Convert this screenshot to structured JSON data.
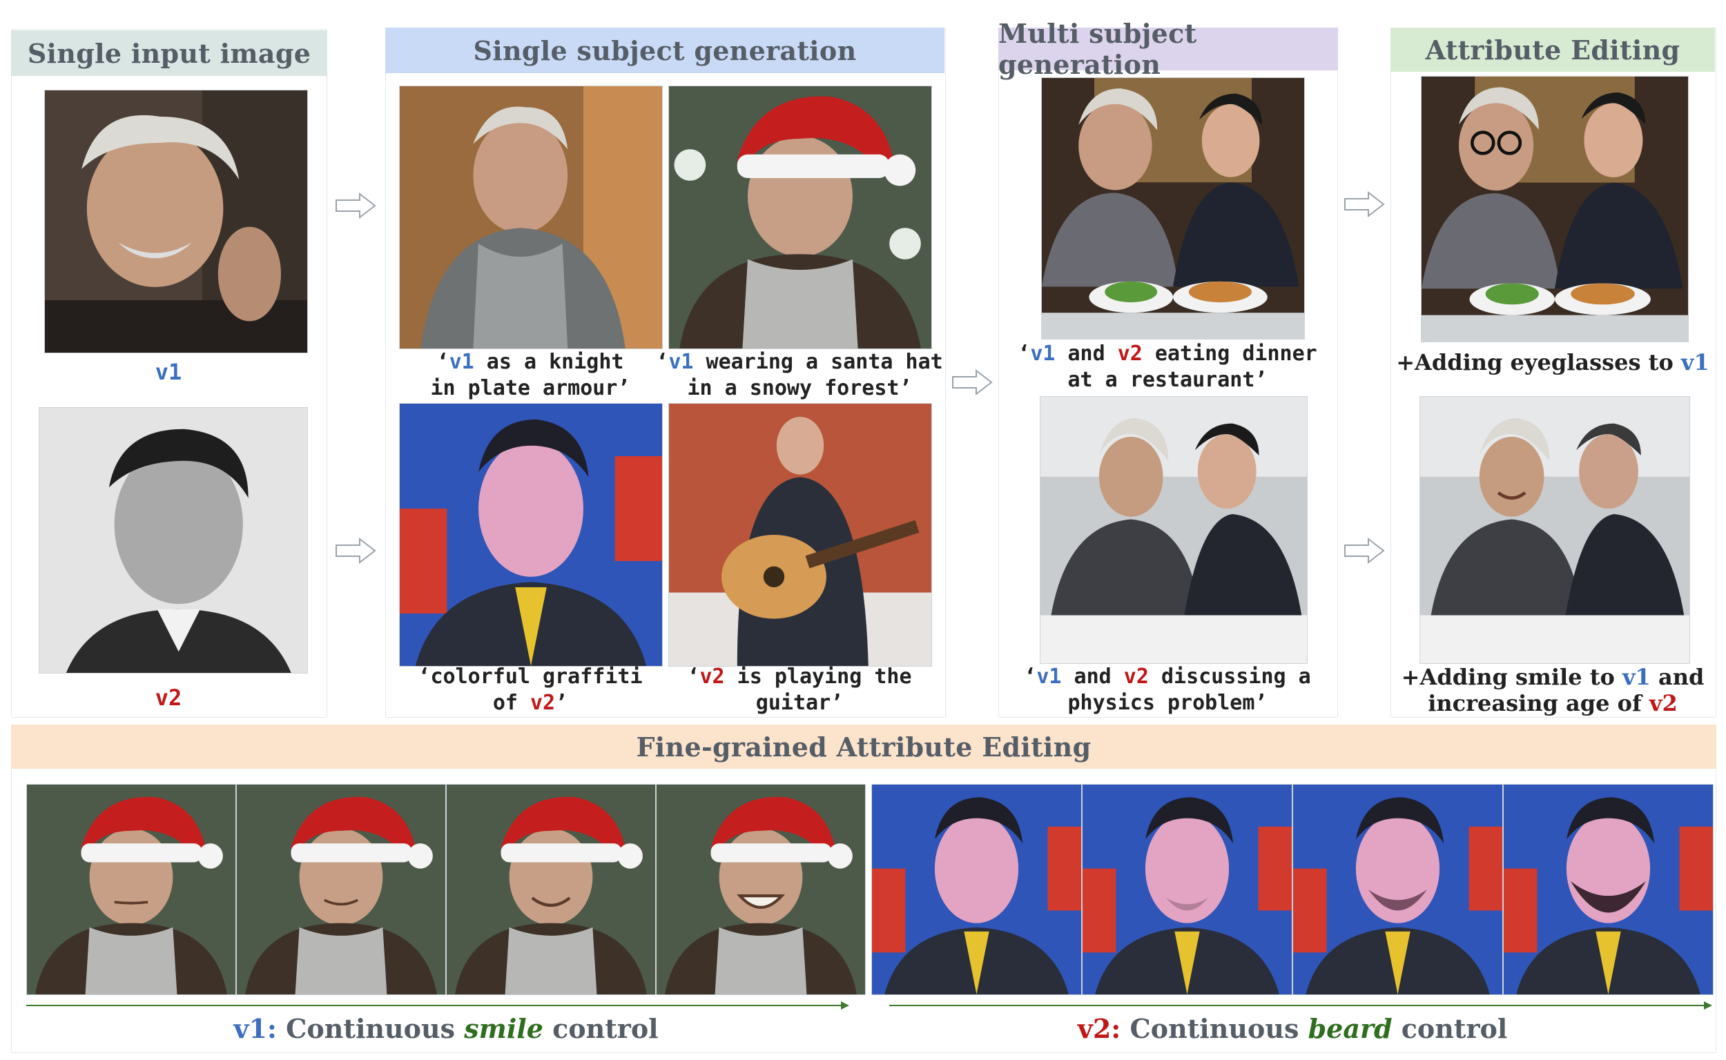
{
  "colors": {
    "input_header_bg": "#d9e6e3",
    "single_header_bg": "#c9daf6",
    "multi_header_bg": "#dcd3ec",
    "attr_header_bg": "#d7ebd3",
    "fine_header_bg": "#fbe3cc",
    "v1_color": "#3c6fc0",
    "v2_color": "#c01818",
    "control_green": "#2e6e1e"
  },
  "input_panel": {
    "title": "Single input image",
    "v1_label": "v1",
    "v2_label": "v2"
  },
  "single_panel": {
    "title": "Single subject generation",
    "cap1": {
      "open": "‘",
      "tok": "v1",
      "line1_rest": " as a knight",
      "line2": "in plate armour’"
    },
    "cap2": {
      "open": "‘",
      "tok": "v1",
      "line1_rest": " wearing a santa hat",
      "line2": "in a snowy forest’"
    },
    "cap3": {
      "line1": "‘colorful graffiti",
      "line2_pre": "of ",
      "tok": "v2",
      "line2_post": "’"
    },
    "cap4": {
      "open": "‘",
      "tok": "v2",
      "line1_rest": " is playing the",
      "line2": "guitar’"
    }
  },
  "multi_panel": {
    "title": "Multi subject generation",
    "cap1": {
      "open": "‘",
      "tok1": "v1",
      "mid": " and ",
      "tok2": "v2",
      "line1_rest": " eating dinner",
      "line2": "at a restaurant’"
    },
    "cap2": {
      "open": "‘",
      "tok1": "v1",
      "mid": " and ",
      "tok2": "v2",
      "line1_rest": " discussing a",
      "line2": "physics problem’"
    }
  },
  "attr_panel": {
    "title": "Attribute Editing",
    "cap1": {
      "pre": "+Adding eyeglasses to ",
      "tok": "v1"
    },
    "cap2": {
      "pre": "+Adding smile to ",
      "tok1": "v1",
      "post": " and",
      "line2_pre": "increasing age of ",
      "tok2": "v2"
    }
  },
  "fine_panel": {
    "title": "Fine-grained Attribute Editing",
    "left_caption": {
      "tok": "v1",
      "colon": ":",
      "pre": " Continuous ",
      "attr": "smile",
      "post": " control"
    },
    "right_caption": {
      "tok": "v2",
      "colon": ":",
      "pre": " Continuous ",
      "attr": "beard",
      "post": " control"
    }
  }
}
